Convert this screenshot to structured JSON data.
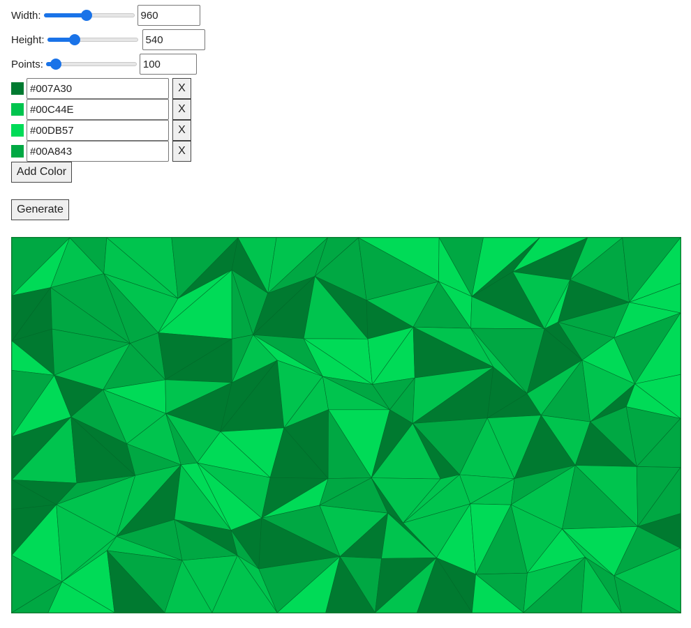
{
  "controls": {
    "width": {
      "label": "Width:",
      "value": "960",
      "fraction": 0.47
    },
    "height": {
      "label": "Height:",
      "value": "540",
      "fraction": 0.3
    },
    "points": {
      "label": "Points:",
      "value": "100",
      "fraction": 0.11
    }
  },
  "colors": [
    {
      "hex": "#007A30",
      "remove_label": "X"
    },
    {
      "hex": "#00C44E",
      "remove_label": "X"
    },
    {
      "hex": "#00DB57",
      "remove_label": "X"
    },
    {
      "hex": "#00A843",
      "remove_label": "X"
    }
  ],
  "buttons": {
    "add_color": "Add Color",
    "generate": "Generate"
  },
  "canvas": {
    "background": "#00A843",
    "stroke": "#006B2A"
  }
}
